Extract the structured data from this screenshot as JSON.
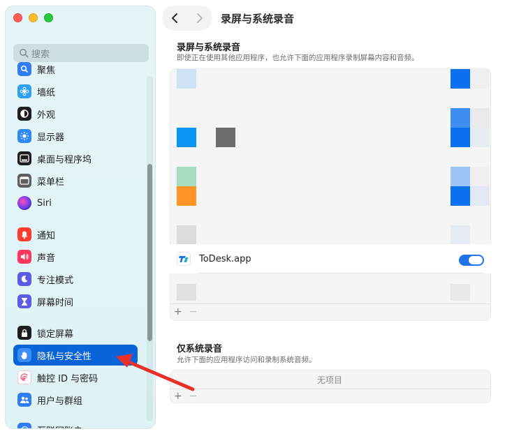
{
  "window": {
    "title": "录屏与系统录音"
  },
  "sidebar": {
    "search_placeholder": "搜索",
    "items": [
      {
        "label": "聚焦",
        "icon": "magnifier-icon",
        "color": "#2f7cf6"
      },
      {
        "label": "墙纸",
        "icon": "flower-icon",
        "color": "#2aa1f3"
      },
      {
        "label": "外观",
        "icon": "appearance-icon",
        "color": "#1d1d1f"
      },
      {
        "label": "显示器",
        "icon": "sun-icon",
        "color": "#2f8af5"
      },
      {
        "label": "桌面与程序坞",
        "icon": "dock-icon",
        "color": "#1d1d1f"
      },
      {
        "label": "菜单栏",
        "icon": "menubar-icon",
        "color": "#5e5e60"
      },
      {
        "label": "Siri",
        "icon": "siri-icon",
        "color": "#3b2d7a"
      },
      {
        "label": "通知",
        "icon": "bell-icon",
        "color": "#ff3b30"
      },
      {
        "label": "声音",
        "icon": "speaker-icon",
        "color": "#ff375f"
      },
      {
        "label": "专注模式",
        "icon": "moon-icon",
        "color": "#5e5ce6"
      },
      {
        "label": "屏幕时间",
        "icon": "hourglass-icon",
        "color": "#5e5ce6"
      },
      {
        "label": "锁定屏幕",
        "icon": "lock-icon",
        "color": "#1d1d1f"
      },
      {
        "label": "隐私与安全性",
        "icon": "hand-icon",
        "color": "#2f7cf6"
      },
      {
        "label": "触控 ID 与密码",
        "icon": "fingerprint-icon",
        "color": "#ff375f"
      },
      {
        "label": "用户与群组",
        "icon": "users-icon",
        "color": "#2f7cf6"
      },
      {
        "label": "互联网账户",
        "icon": "at-icon",
        "color": "#2f7cf6"
      }
    ]
  },
  "main": {
    "section1": {
      "title": "录屏与系统录音",
      "description": "即使正在使用其他应用程序，也允许下面的应用程序录制屏幕内容和音频。",
      "app": {
        "name": "ToDesk.app",
        "enabled": true
      },
      "add_label": "+",
      "remove_label": "−"
    },
    "section2": {
      "title": "仅系统录音",
      "description": "允许下面的应用程序访问和录制系统音频。",
      "empty_label": "无项目",
      "add_label": "+",
      "remove_label": "−"
    }
  },
  "colors": {
    "accent": "#0a63d8",
    "toggle_on": "#1e74e8",
    "arrow": "#e8302a"
  }
}
